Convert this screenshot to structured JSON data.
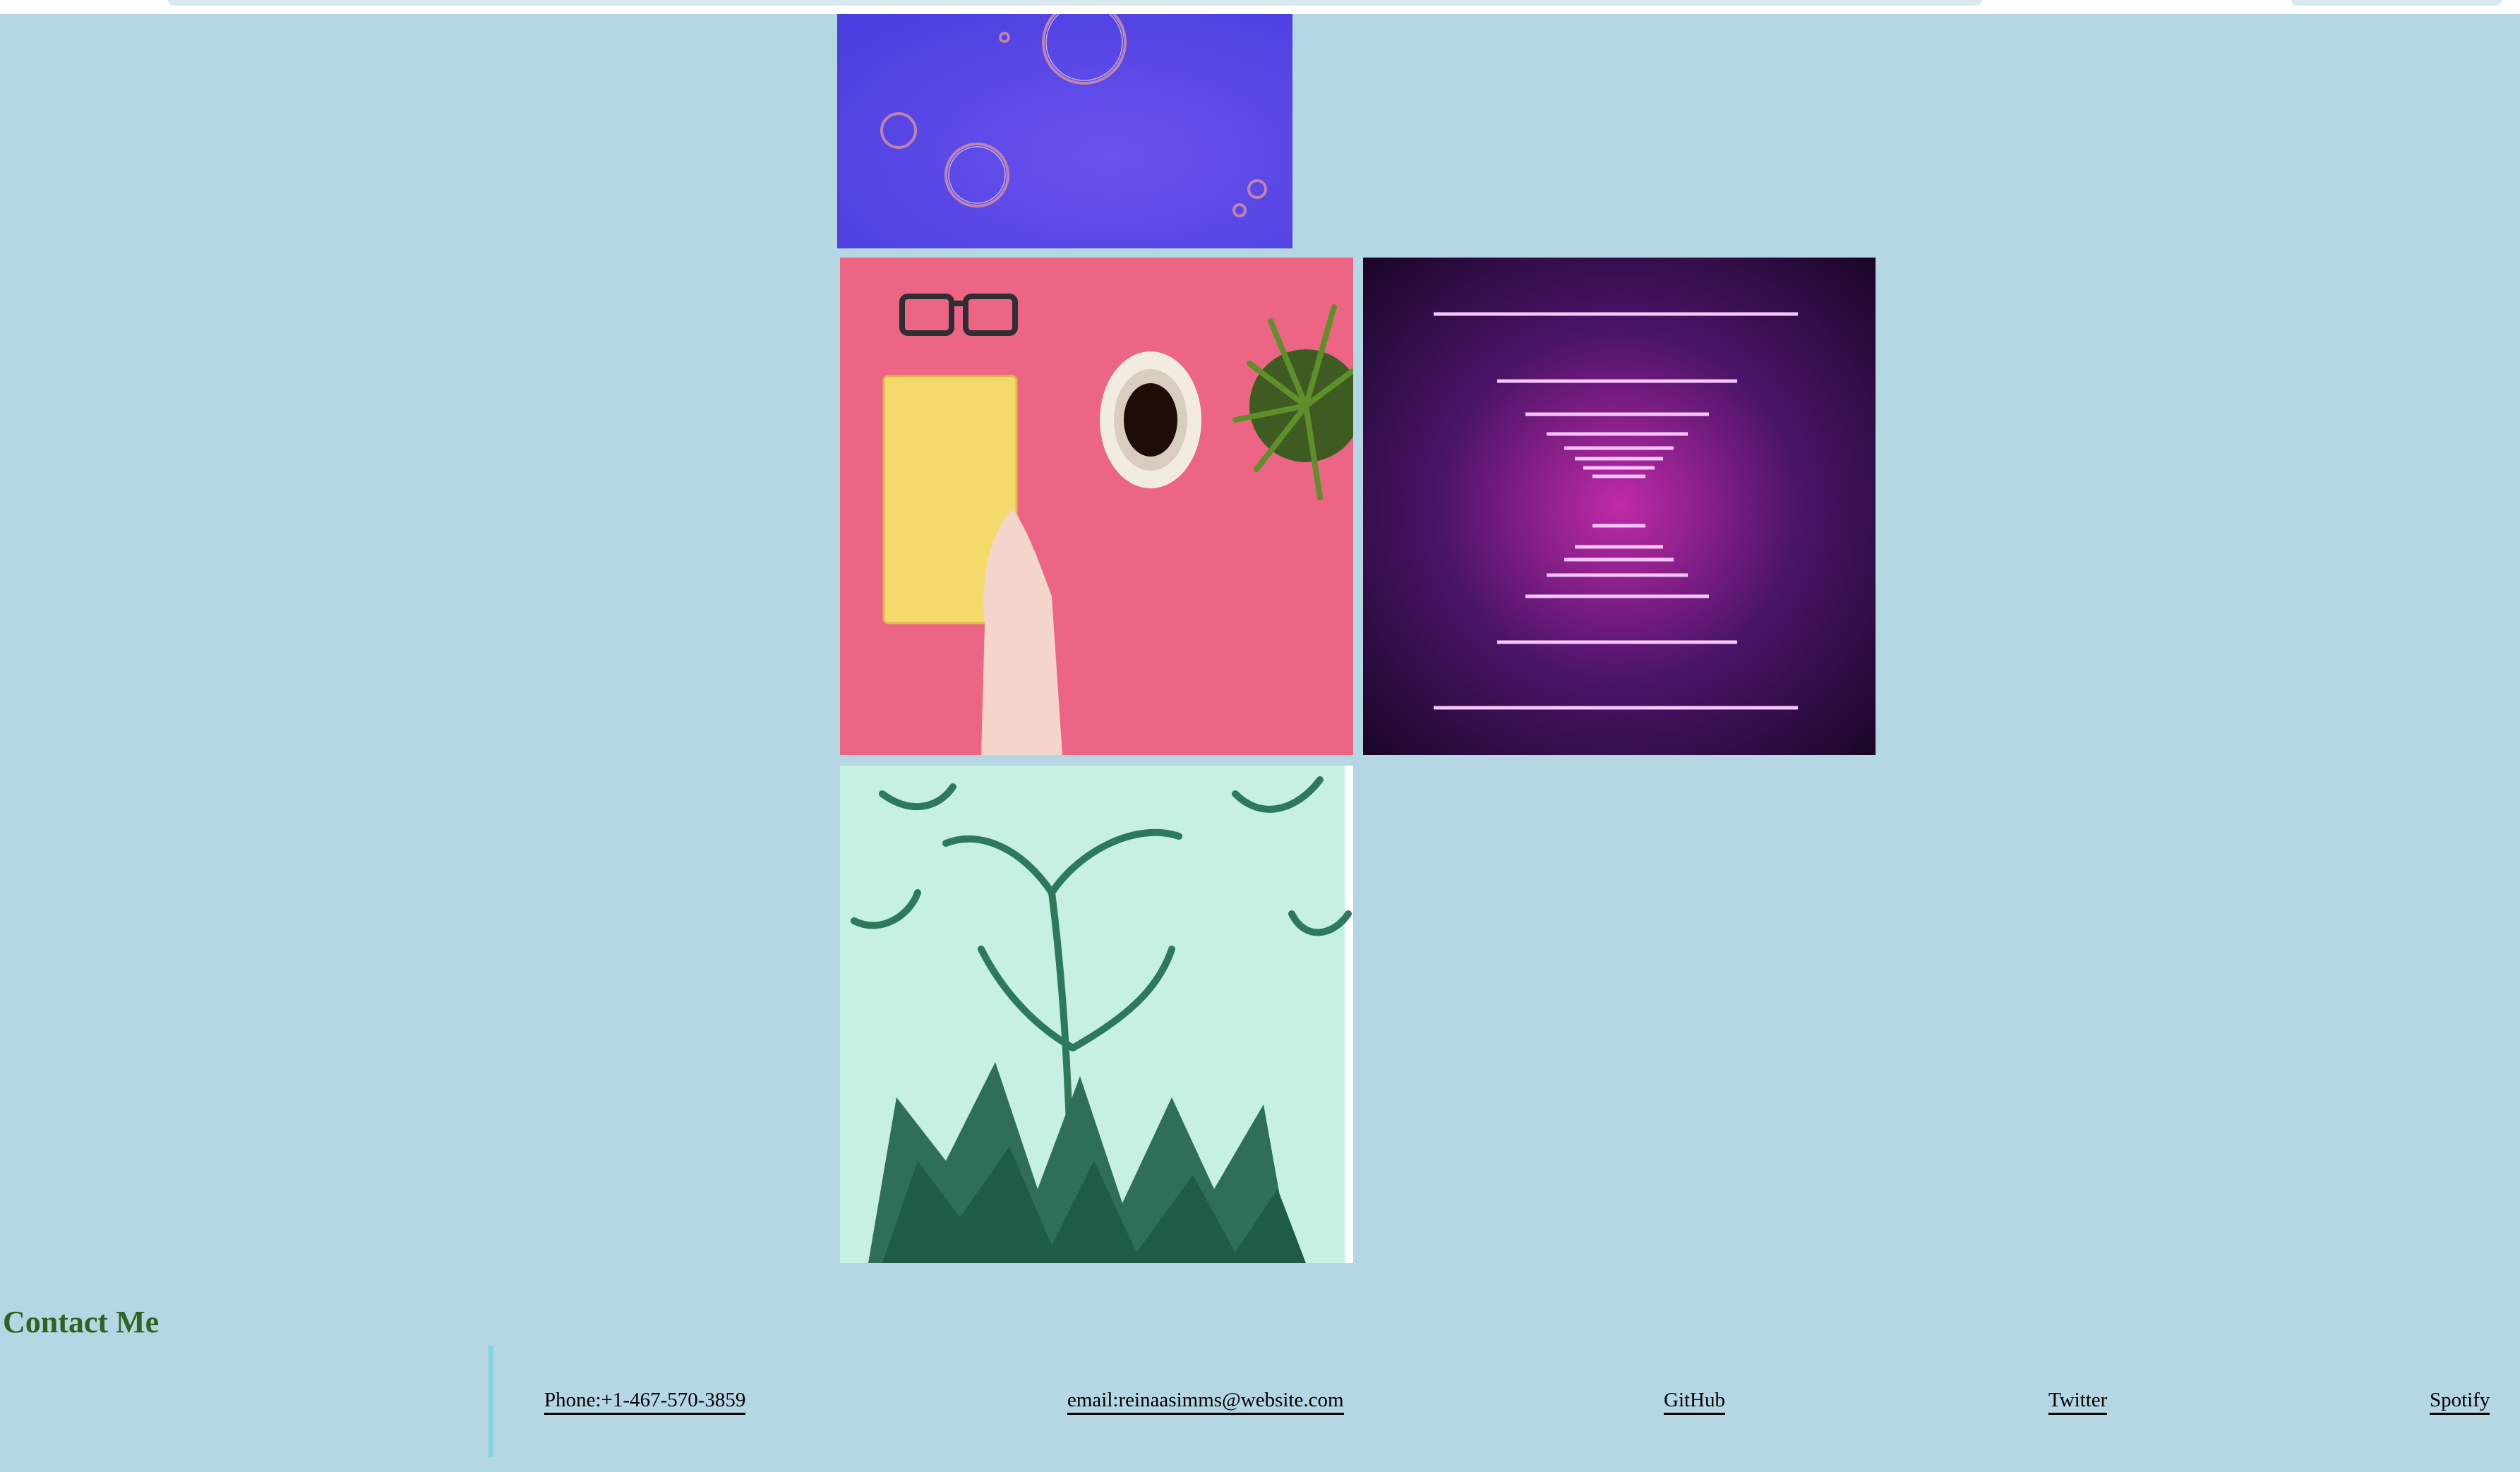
{
  "background_color": "#b5d6e3",
  "accent_color": "#2e6322",
  "divider_color": "#84d4e4",
  "gallery": [
    {
      "name": "bubbles-photo",
      "description_icon": "purple-bubbles-image"
    },
    {
      "name": "desk-photo",
      "description_icon": "pink-desk-flatlay-image"
    },
    {
      "name": "neon-tunnel-photo",
      "description_icon": "neon-tunnel-image"
    },
    {
      "name": "floral-photo",
      "description_icon": "green-floral-image"
    }
  ],
  "contact": {
    "heading": "Contact Me",
    "links": {
      "phone": "Phone:+1-467-570-3859",
      "email": "email:reinaasimms@website.com",
      "github": "GitHub",
      "twitter": "Twitter",
      "spotify": "Spotify"
    }
  }
}
